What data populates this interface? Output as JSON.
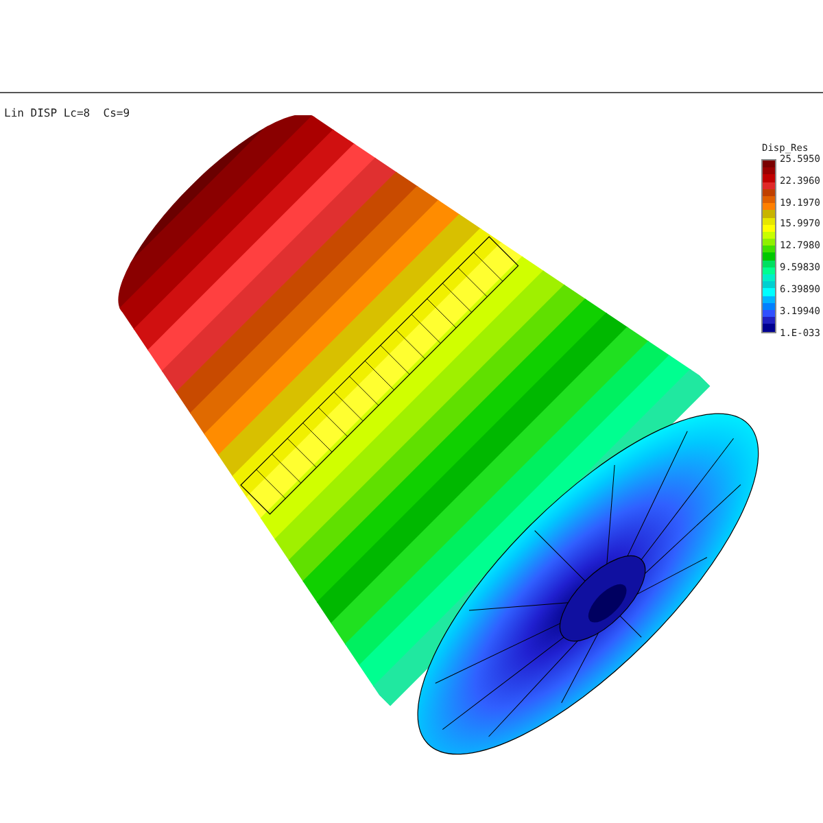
{
  "viewport": {
    "title": "Lin DISP Lc=8  Cs=9"
  },
  "legend": {
    "title": "Disp_Res",
    "bands": [
      {
        "color": "#7a0000"
      },
      {
        "color": "#9a0000"
      },
      {
        "color": "#c00000"
      },
      {
        "color": "#e02828"
      },
      {
        "color": "#c04000"
      },
      {
        "color": "#e06000"
      },
      {
        "color": "#ff8000"
      },
      {
        "color": "#c8b400"
      },
      {
        "color": "#e6e600"
      },
      {
        "color": "#ffff00"
      },
      {
        "color": "#c8ff00"
      },
      {
        "color": "#90f000"
      },
      {
        "color": "#40e000"
      },
      {
        "color": "#00c800"
      },
      {
        "color": "#00e060"
      },
      {
        "color": "#00ff90"
      },
      {
        "color": "#00f0c8"
      },
      {
        "color": "#00d0d0"
      },
      {
        "color": "#00ffff"
      },
      {
        "color": "#00b4ff"
      },
      {
        "color": "#0080ff"
      },
      {
        "color": "#3050ff"
      },
      {
        "color": "#2020c0"
      },
      {
        "color": "#000090"
      }
    ],
    "labels": [
      "25.5950",
      "22.3960",
      "19.1970",
      "15.9970",
      "12.7980",
      "9.59830",
      "6.39890",
      "3.19940",
      "1.E-033"
    ]
  }
}
